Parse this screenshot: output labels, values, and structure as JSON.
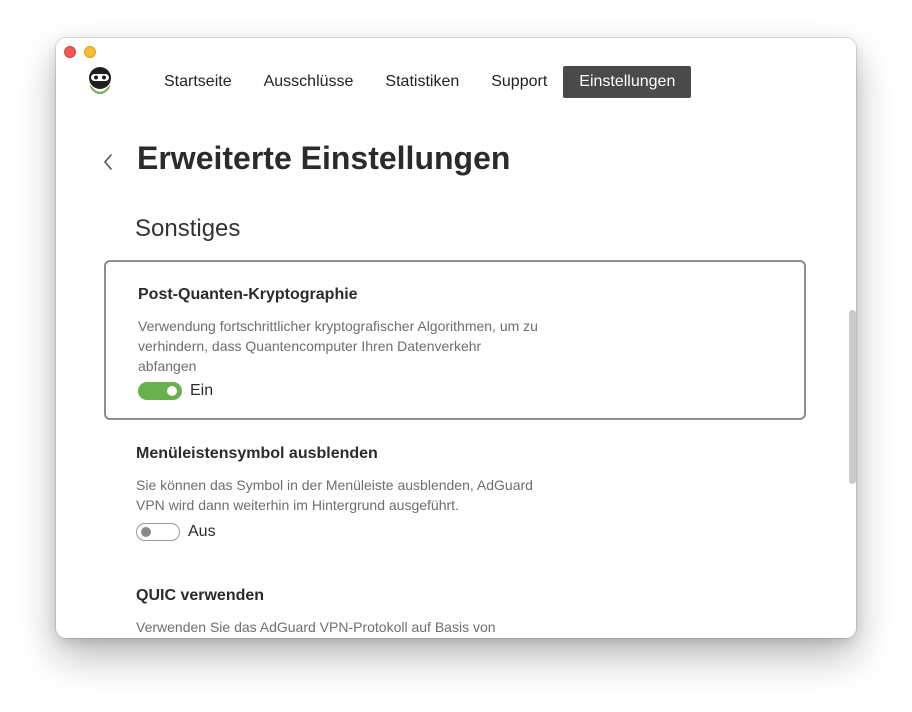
{
  "window": {
    "controls": [
      "close-button",
      "minimize-button"
    ]
  },
  "nav": {
    "items": [
      {
        "label": "Startseite"
      },
      {
        "label": "Ausschlüsse"
      },
      {
        "label": "Statistiken"
      },
      {
        "label": "Support"
      },
      {
        "label": "Einstellungen",
        "active": true
      }
    ]
  },
  "page": {
    "title": "Erweiterte Einstellungen",
    "back_icon": "chevron-left-icon"
  },
  "section": {
    "title": "Sonstiges"
  },
  "settings": [
    {
      "title": "Post-Quanten-Kryptographie",
      "description": "Verwendung fortschrittlicher kryptografischer Algorithmen, um zu verhindern, dass Quantencomputer Ihren Datenverkehr abfangen",
      "state": "Ein",
      "enabled": true
    },
    {
      "title": "Menüleistensymbol ausblenden",
      "description": "Sie können das Symbol in der Menüleiste ausblenden, AdGuard VPN wird dann weiterhin im Hintergrund ausgeführt.",
      "state": "Aus",
      "enabled": false
    },
    {
      "title": "QUIC verwenden",
      "description": "Verwenden Sie das AdGuard VPN-Protokoll auf Basis von"
    }
  ],
  "colors": {
    "accent_green": "#67b24c",
    "active_tab": "#4a4a4a",
    "close": "#ee5a52",
    "minimize": "#f5bd2f"
  }
}
